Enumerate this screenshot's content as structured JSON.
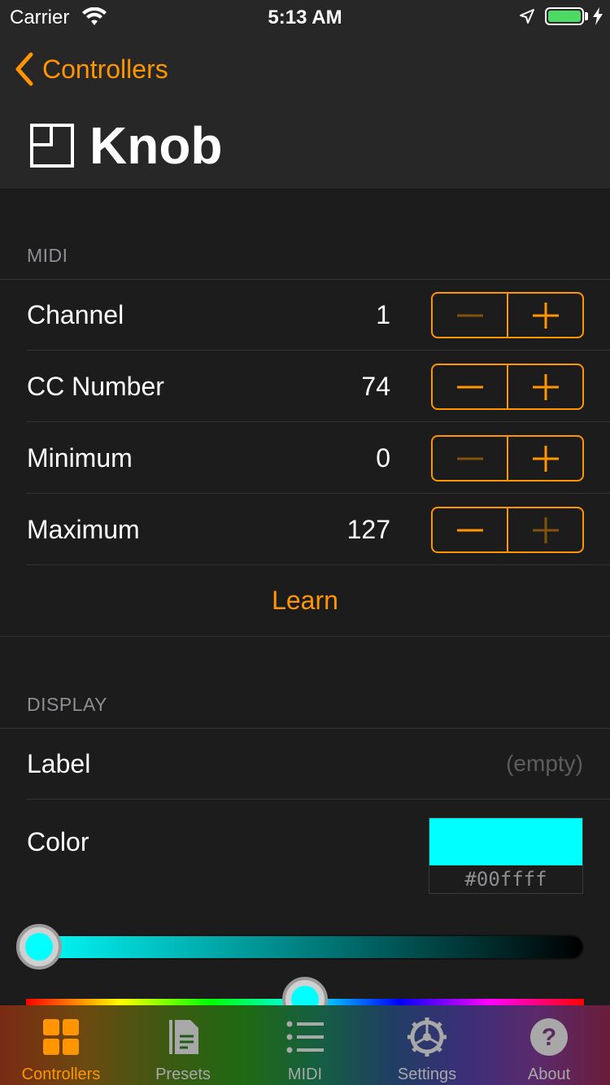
{
  "status_bar": {
    "carrier": "Carrier",
    "time": "5:13 AM",
    "battery_level": 1.0
  },
  "nav": {
    "back_label": "Controllers",
    "title": "Knob",
    "title_icon": "knob-icon"
  },
  "midi_section": {
    "header": "MIDI",
    "rows": [
      {
        "label": "Channel",
        "value": "1",
        "minus_enabled": false,
        "plus_enabled": true
      },
      {
        "label": "CC Number",
        "value": "74",
        "minus_enabled": true,
        "plus_enabled": true
      },
      {
        "label": "Minimum",
        "value": "0",
        "minus_enabled": false,
        "plus_enabled": true
      },
      {
        "label": "Maximum",
        "value": "127",
        "minus_enabled": true,
        "plus_enabled": false
      }
    ],
    "learn_label": "Learn"
  },
  "display_section": {
    "header": "DISPLAY",
    "label_row": {
      "label": "Label",
      "placeholder": "(empty)"
    },
    "color_row": {
      "label": "Color",
      "hex": "#00ffff"
    },
    "brightness_slider": {
      "value": 0.0
    },
    "hue_slider": {
      "value": 0.5
    }
  },
  "tabs": [
    {
      "label": "Controllers",
      "icon": "grid-icon",
      "active": true
    },
    {
      "label": "Presets",
      "icon": "document-icon",
      "active": false
    },
    {
      "label": "MIDI",
      "icon": "list-icon",
      "active": false
    },
    {
      "label": "Settings",
      "icon": "gear-icon",
      "active": false
    },
    {
      "label": "About",
      "icon": "help-icon",
      "active": false
    }
  ],
  "colors": {
    "accent": "#ff9500",
    "selected_color": "#00ffff",
    "background": "#1c1c1c",
    "nav_background": "#272727"
  }
}
